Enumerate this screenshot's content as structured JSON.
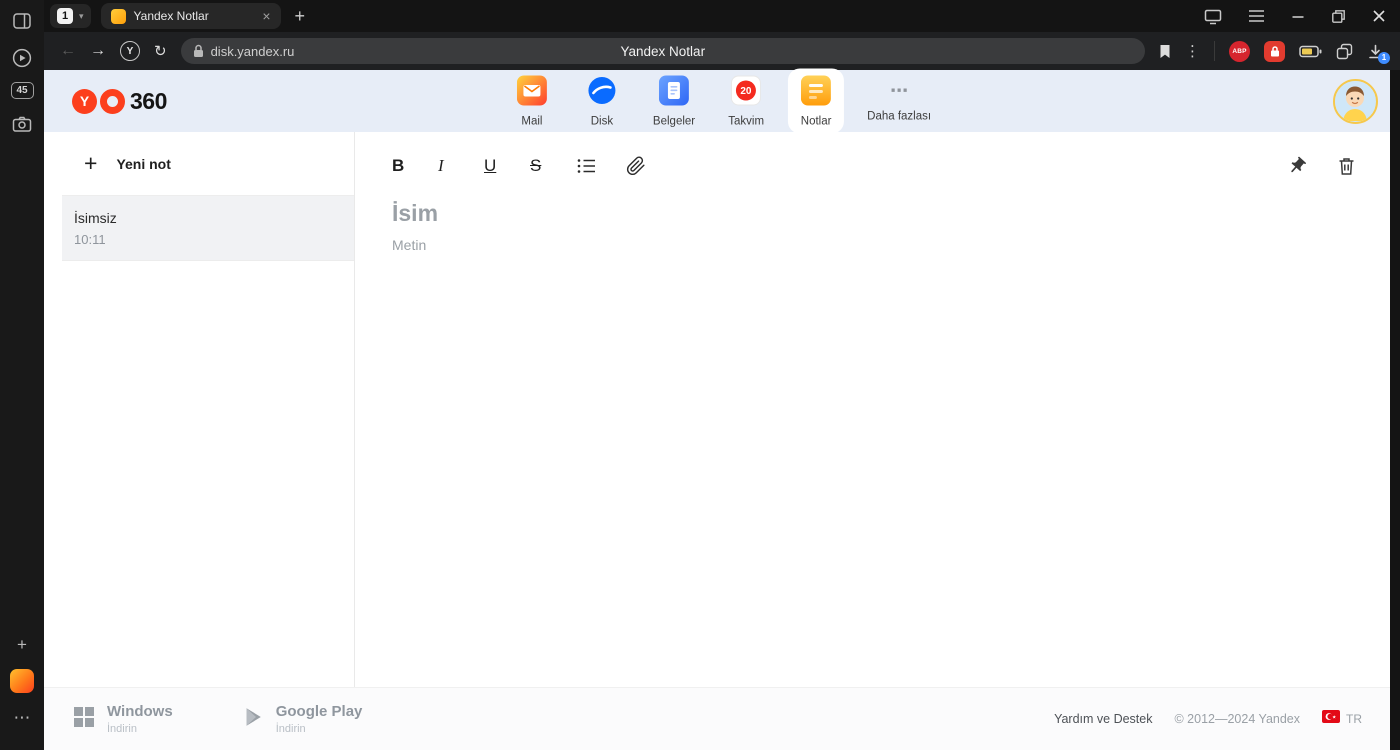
{
  "colors": {
    "header_band": "#e7edf7",
    "accent_red": "#fc3f1d",
    "download_badge_blue": "#3f8cff",
    "avatar_ring": "#f6c84c"
  },
  "icons": {
    "plus": "+",
    "close": "×",
    "back": "←",
    "forward": "→",
    "refresh": "↻",
    "more_vertical": "⋮",
    "more_horizontal": "⋯",
    "caret_down": "▾"
  },
  "browser": {
    "rail": {
      "tab_counter": "45"
    },
    "tabbar": {
      "group_badge": "1",
      "active_tab_title": "Yandex Notlar"
    },
    "addressbar": {
      "browser_letter": "Y",
      "url": "disk.yandex.ru",
      "page_title": "Yandex Notlar"
    },
    "extensions": {
      "abp": "ABP",
      "download_badge": "1"
    }
  },
  "service_header": {
    "logo_letter": "Y",
    "logo_suffix": "360",
    "nav": [
      {
        "label": "Mail"
      },
      {
        "label": "Disk"
      },
      {
        "label": "Belgeler"
      },
      {
        "label": "Takvim",
        "badge": "20"
      },
      {
        "label": "Notlar"
      },
      {
        "label": "Daha fazlası"
      }
    ]
  },
  "notes": {
    "new_note": "Yeni not",
    "items": [
      {
        "title": "İsimsiz",
        "time": "10:11"
      }
    ],
    "toolbar": {
      "bold": "B",
      "italic": "I",
      "underline": "U",
      "strike": "S"
    },
    "editor": {
      "title_placeholder": "İsim",
      "body_placeholder": "Metin"
    }
  },
  "footer": {
    "downloads": [
      {
        "name": "Windows",
        "action": "İndirin"
      },
      {
        "name": "Google Play",
        "action": "İndirin"
      }
    ],
    "help": "Yardım ve Destek",
    "copyright": "© 2012—2024 Yandex",
    "language": "TR"
  }
}
